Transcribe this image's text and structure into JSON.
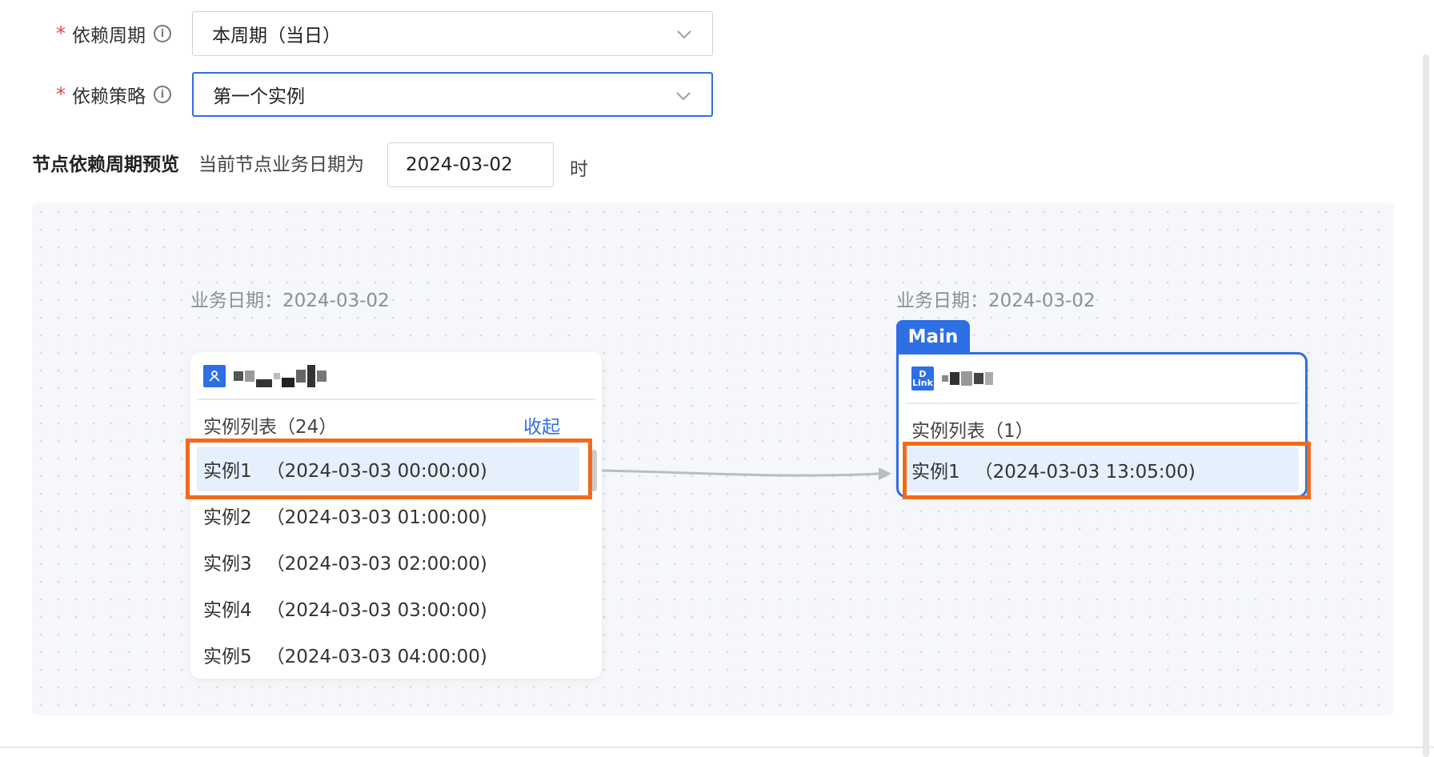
{
  "form": {
    "cycle": {
      "label": "依赖周期",
      "value": "本周期（当日）"
    },
    "strategy": {
      "label": "依赖策略",
      "value": "第一个实例"
    }
  },
  "preview": {
    "title": "节点依赖周期预览",
    "desc": "当前节点业务日期为",
    "date": "2024-03-02",
    "suffix": "时"
  },
  "upstream": {
    "biz_date": "业务日期：2024-03-02",
    "list_header": "实例列表（24）",
    "collapse_label": "收起",
    "instances": [
      {
        "name": "实例1",
        "time": "（2024-03-03 00:00:00)"
      },
      {
        "name": "实例2",
        "time": "（2024-03-03 01:00:00)"
      },
      {
        "name": "实例3",
        "time": "（2024-03-03 02:00:00)"
      },
      {
        "name": "实例4",
        "time": "（2024-03-03 03:00:00)"
      },
      {
        "name": "实例5",
        "time": "（2024-03-03 04:00:00)"
      }
    ]
  },
  "current": {
    "biz_date": "业务日期：2024-03-02",
    "tag": "Main",
    "icon_text": "D\nLink",
    "list_header": "实例列表（1）",
    "instances": [
      {
        "name": "实例1",
        "time": "（2024-03-03 13:05:00)"
      }
    ]
  },
  "colors": {
    "accent": "#2f6fe4",
    "highlight": "#f26a1b",
    "selected_bg": "#e6effc",
    "required": "#e5484d"
  }
}
